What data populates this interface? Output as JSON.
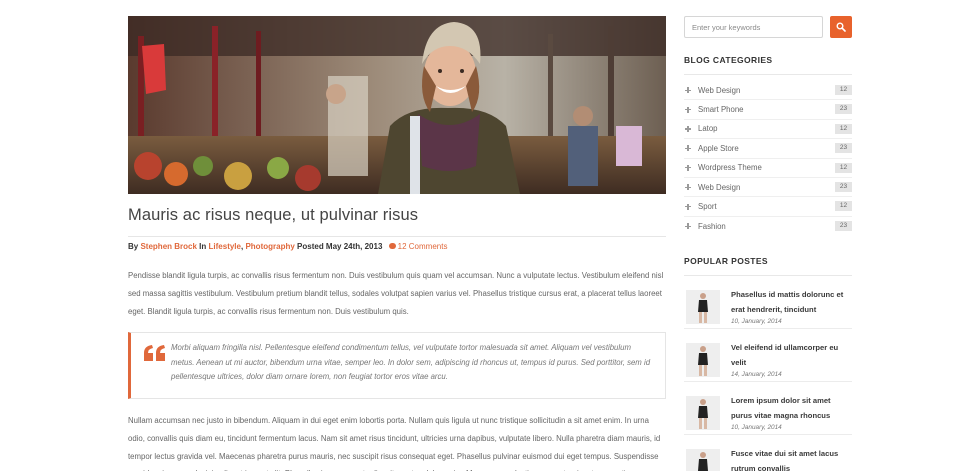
{
  "post": {
    "hero_image": "photo of smiling woman with beanie at outdoor market",
    "title": "Mauris ac risus neque, ut pulvinar risus",
    "meta": {
      "by_prefix": "By",
      "author": "Stephen Brock",
      "in_word": "In",
      "category1": "Lifestyle",
      "separator": ",",
      "category2": "Photography",
      "posted": "Posted May 24th, 2013",
      "comments": "12 Comments"
    },
    "paragraph1": "Pendisse blandit ligula turpis, ac convallis risus fermentum non. Duis vestibulum quis quam vel accumsan. Nunc a vulputate lectus. Vestibulum eleifend nisl sed massa sagittis vestibulum. Vestibulum pretium blandit tellus, sodales volutpat sapien varius vel. Phasellus tristique cursus erat, a placerat tellus laoreet eget. Blandit ligula turpis, ac convallis risus fermentum non. Duis vestibulum quis.",
    "blockquote": "Morbi aliquam fringilla nisl. Pellentesque eleifend condimentum tellus, vel vulputate tortor malesuada sit amet. Aliquam vel vestibulum metus. Aenean ut mi auctor, bibendum urna vitae, semper leo. In dolor sem, adipiscing id rhoncus ut, tempus id purus. Sed porttitor, sem id pellentesque ultrices, dolor diam ornare lorem, non feugiat tortor eros vitae arcu.",
    "paragraph2": "Nullam accumsan nec justo in bibendum. Aliquam in dui eget enim lobortis porta. Nullam quis ligula ut nunc tristique sollicitudin a sit amet enim. In urna odio, convallis quis diam eu, tincidunt fermentum lacus. Nam sit amet risus tincidunt, ultricies urna dapibus, vulputate libero. Nulla pharetra diam mauris, id tempor lectus gravida vel. Maecenas pharetra purus mauris, nec suscipit risus consequat eget. Phasellus pulvinar euismod dui eget tempus. Suspendisse gravida mi ac nunc lacinia aliquet in eget elit. Phasellus in consequat odio, sit amet sodales enim. Maecenas molestie semper turpis, et venenatis quam feugiat gravida. Donec sit amet velit sollicitudin, malesuada sapien quis, tempor lectus."
  },
  "sidebar": {
    "search": {
      "placeholder": "Enter your keywords",
      "icon": "search-icon"
    },
    "categories_title": "BLOG CATEGORIES",
    "categories": [
      {
        "label": "Web Design",
        "count": "12"
      },
      {
        "label": "Smart Phone",
        "count": "23"
      },
      {
        "label": "Latop",
        "count": "12"
      },
      {
        "label": "Apple Store",
        "count": "23"
      },
      {
        "label": "Wordpress Theme",
        "count": "12"
      },
      {
        "label": "Web Design",
        "count": "23"
      },
      {
        "label": "Sport",
        "count": "12"
      },
      {
        "label": "Fashion",
        "count": "23"
      }
    ],
    "popular_title": "POPULAR POSTES",
    "popular": [
      {
        "title": "Phasellus id mattis dolorunc et erat hendrerit, tincidunt",
        "date": "10, January, 2014"
      },
      {
        "title": "Vel eleifend id ullamcorper eu velit",
        "date": "14, January, 2014"
      },
      {
        "title": "Lorem ipsum dolor sit amet purus vitae magna rhoncus",
        "date": "10, January, 2014"
      },
      {
        "title": "Fusce vitae dui sit amet lacus rutrum convallis",
        "date": ""
      }
    ]
  },
  "colors": {
    "accent": "#e0683b",
    "search_button": "#e8622c"
  }
}
